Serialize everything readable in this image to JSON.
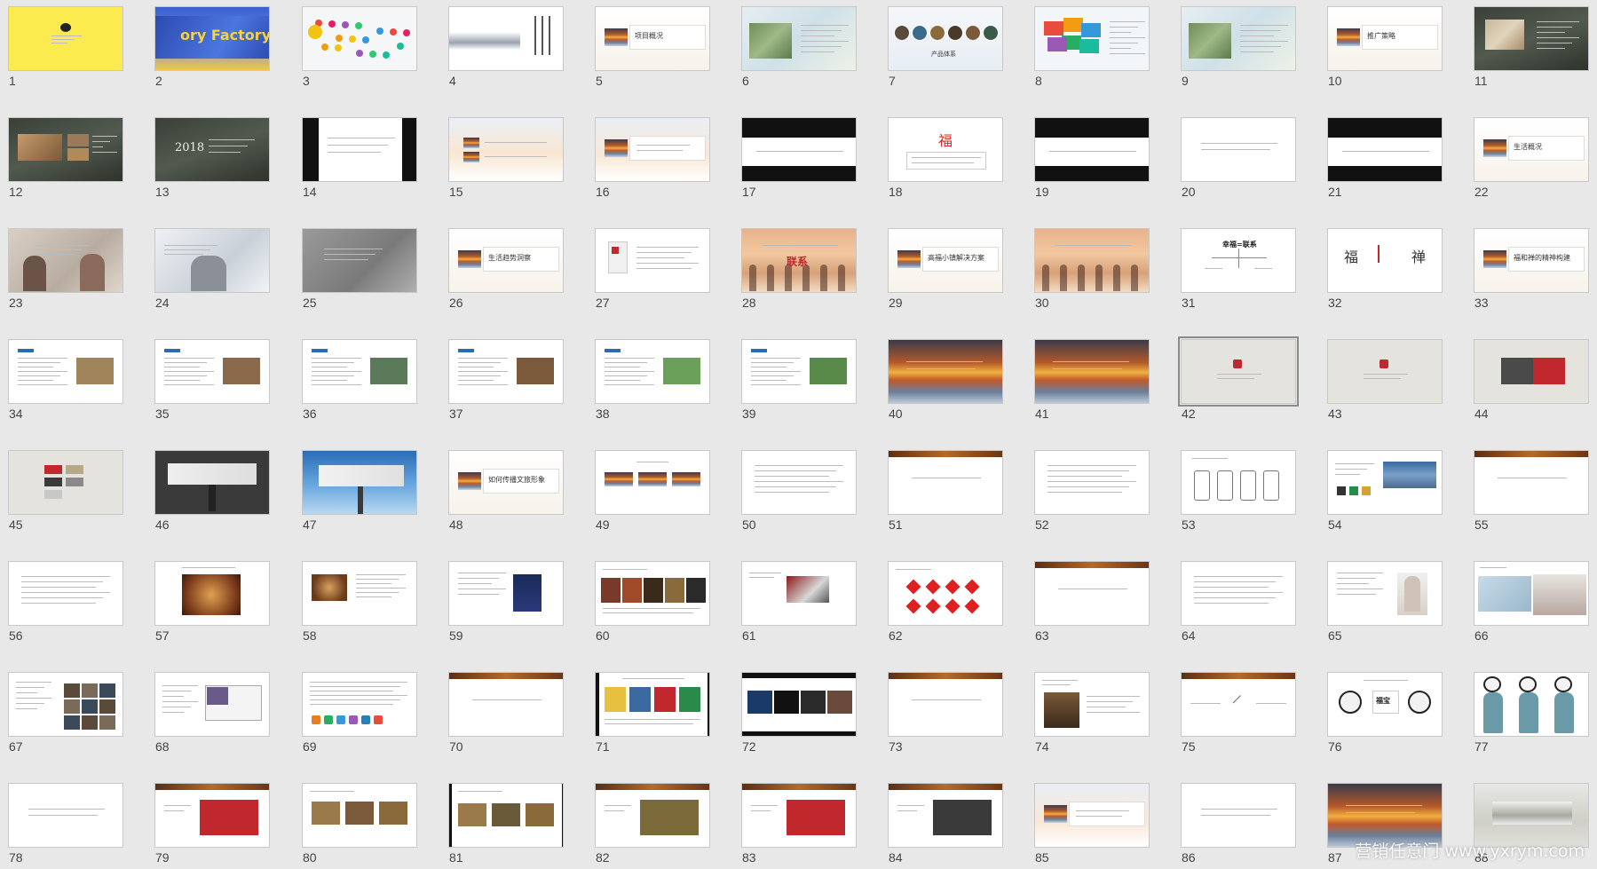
{
  "slides": [
    {
      "num": "1",
      "kind": "yellow"
    },
    {
      "num": "2",
      "kind": "factory",
      "caption": "ory Factory"
    },
    {
      "num": "3",
      "kind": "bubbles"
    },
    {
      "num": "4",
      "kind": "inkscape"
    },
    {
      "num": "5",
      "kind": "sunset-title",
      "caption": "项目概况"
    },
    {
      "num": "6",
      "kind": "map"
    },
    {
      "num": "7",
      "kind": "circles",
      "caption": "产品体系"
    },
    {
      "num": "8",
      "kind": "colormap"
    },
    {
      "num": "9",
      "kind": "map"
    },
    {
      "num": "10",
      "kind": "sunset-title",
      "caption": "推广策略"
    },
    {
      "num": "11",
      "kind": "forest-plan"
    },
    {
      "num": "12",
      "kind": "forest-photos"
    },
    {
      "num": "13",
      "kind": "forest-text",
      "caption": "2018"
    },
    {
      "num": "14",
      "kind": "black-sides"
    },
    {
      "num": "15",
      "kind": "sky-list"
    },
    {
      "num": "16",
      "kind": "sky-title"
    },
    {
      "num": "17",
      "kind": "band"
    },
    {
      "num": "18",
      "kind": "fu",
      "caption": "福"
    },
    {
      "num": "19",
      "kind": "band"
    },
    {
      "num": "20",
      "kind": "plain-text"
    },
    {
      "num": "21",
      "kind": "band"
    },
    {
      "num": "22",
      "kind": "sunset-title",
      "caption": "生活概况"
    },
    {
      "num": "23",
      "kind": "people"
    },
    {
      "num": "24",
      "kind": "people-light"
    },
    {
      "num": "25",
      "kind": "grey-photo"
    },
    {
      "num": "26",
      "kind": "sunset-title",
      "caption": "生活趋势洞察"
    },
    {
      "num": "27",
      "kind": "book"
    },
    {
      "num": "28",
      "kind": "beach",
      "caption": "联系"
    },
    {
      "num": "29",
      "kind": "sunset-title",
      "caption": "高福小镇解决方案"
    },
    {
      "num": "30",
      "kind": "beach"
    },
    {
      "num": "31",
      "kind": "diagram",
      "caption": "幸福=联系"
    },
    {
      "num": "32",
      "kind": "fuchan",
      "caption": "福",
      "caption2": "禅"
    },
    {
      "num": "33",
      "kind": "sunset-title",
      "caption": "福和禅的精神构建"
    },
    {
      "num": "34",
      "kind": "article"
    },
    {
      "num": "35",
      "kind": "article"
    },
    {
      "num": "36",
      "kind": "article"
    },
    {
      "num": "37",
      "kind": "article"
    },
    {
      "num": "38",
      "kind": "article"
    },
    {
      "num": "39",
      "kind": "article"
    },
    {
      "num": "40",
      "kind": "sunset-full"
    },
    {
      "num": "41",
      "kind": "sunset-full"
    },
    {
      "num": "42",
      "kind": "logo-grey",
      "selected": true
    },
    {
      "num": "43",
      "kind": "logo-grey"
    },
    {
      "num": "44",
      "kind": "logo-card"
    },
    {
      "num": "45",
      "kind": "swatches"
    },
    {
      "num": "46",
      "kind": "billboard-dark"
    },
    {
      "num": "47",
      "kind": "billboard-sky"
    },
    {
      "num": "48",
      "kind": "sunset-title",
      "caption": "如何传播文旅形象"
    },
    {
      "num": "49",
      "kind": "three-photos"
    },
    {
      "num": "50",
      "kind": "bullets"
    },
    {
      "num": "51",
      "kind": "brown-title"
    },
    {
      "num": "52",
      "kind": "bullets"
    },
    {
      "num": "53",
      "kind": "phones"
    },
    {
      "num": "54",
      "kind": "text-photo"
    },
    {
      "num": "55",
      "kind": "brown-title"
    },
    {
      "num": "56",
      "kind": "bullets"
    },
    {
      "num": "57",
      "kind": "warm-photo"
    },
    {
      "num": "58",
      "kind": "warm-small"
    },
    {
      "num": "59",
      "kind": "portrait"
    },
    {
      "num": "60",
      "kind": "strip-photos"
    },
    {
      "num": "61",
      "kind": "red-object"
    },
    {
      "num": "62",
      "kind": "diamonds"
    },
    {
      "num": "63",
      "kind": "brown-title"
    },
    {
      "num": "64",
      "kind": "bullets"
    },
    {
      "num": "65",
      "kind": "woman"
    },
    {
      "num": "66",
      "kind": "collage"
    },
    {
      "num": "67",
      "kind": "grid-photos"
    },
    {
      "num": "68",
      "kind": "screen"
    },
    {
      "num": "69",
      "kind": "icons"
    },
    {
      "num": "70",
      "kind": "brown-title"
    },
    {
      "num": "71",
      "kind": "framed-colorful"
    },
    {
      "num": "72",
      "kind": "framed-dark"
    },
    {
      "num": "73",
      "kind": "brown-title"
    },
    {
      "num": "74",
      "kind": "market"
    },
    {
      "num": "75",
      "kind": "cross"
    },
    {
      "num": "76",
      "kind": "pandas-small",
      "caption": "福宝"
    },
    {
      "num": "77",
      "kind": "pandas"
    },
    {
      "num": "78",
      "kind": "plain-text"
    },
    {
      "num": "79",
      "kind": "brown-art"
    },
    {
      "num": "80",
      "kind": "paintings"
    },
    {
      "num": "81",
      "kind": "paintings-framed"
    },
    {
      "num": "82",
      "kind": "brown-art"
    },
    {
      "num": "83",
      "kind": "brown-art"
    },
    {
      "num": "84",
      "kind": "brown-art"
    },
    {
      "num": "85",
      "kind": "sky-title"
    },
    {
      "num": "86",
      "kind": "plain-text"
    },
    {
      "num": "87",
      "kind": "sunset-full"
    },
    {
      "num": "88",
      "kind": "landscape-grey"
    }
  ],
  "watermark": "营销任意门 www.yxrym.com",
  "colors": {
    "background": "#e8e8e8",
    "brand_red": "#c0282d",
    "swatch_grey": "#7a7a7a"
  }
}
